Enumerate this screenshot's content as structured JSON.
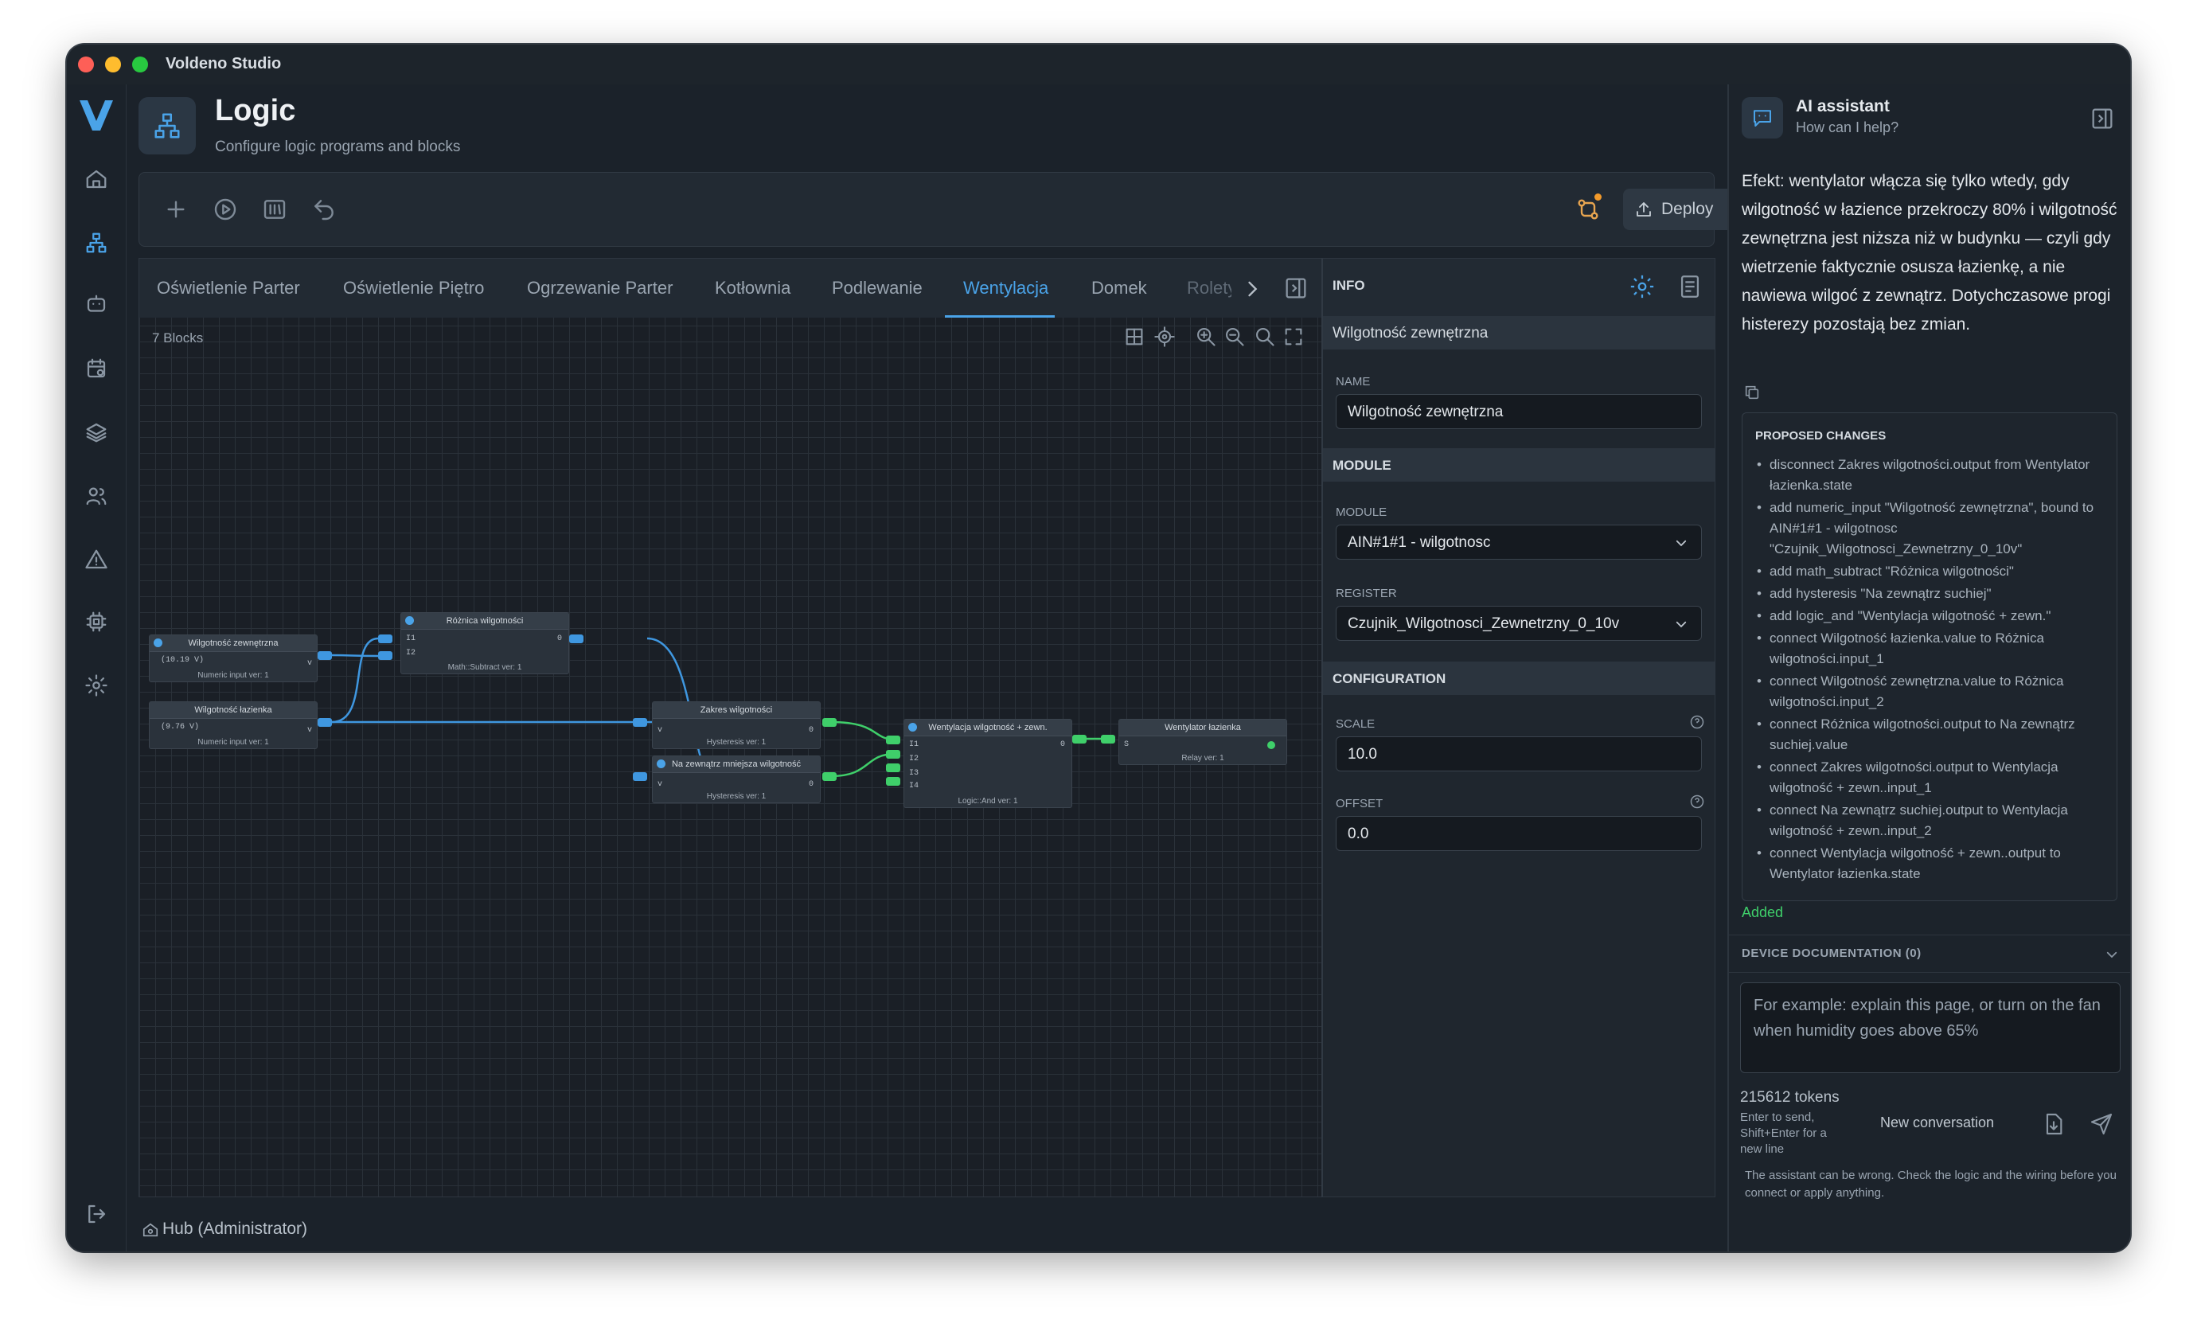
{
  "window": {
    "title": "Voldeno Studio"
  },
  "header": {
    "title": "Logic",
    "subtitle": "Configure logic programs and blocks"
  },
  "toolbar": {
    "deploy_label": "Deploy"
  },
  "tabs": [
    "Oświetlenie Parter",
    "Oświetlenie Piętro",
    "Ogrzewanie Parter",
    "Kotłownia",
    "Podlewanie",
    "Wentylacja",
    "Domek",
    "Rolety"
  ],
  "active_tab": "Wentylacja",
  "canvas": {
    "blocks_count": "7 Blocks",
    "blocks": [
      {
        "title": "Wilgotność zewnętrzna",
        "value": "(10.19 V)",
        "footer": "Numeric input ver: 1",
        "port": "v"
      },
      {
        "title": "Wilgotność łazienka",
        "value": "(9.76 V)",
        "footer": "Numeric input ver: 1",
        "port": "v"
      },
      {
        "title": "Różnica wilgotności",
        "footer": "Math::Subtract ver: 1",
        "in1": "I1",
        "in2": "I2",
        "out": "0"
      },
      {
        "title": "Zakres wilgotności",
        "footer": "Hysteresis ver: 1",
        "in": "v",
        "out": "0"
      },
      {
        "title": "Na zewnątrz mniejsza wilgotność",
        "footer": "Hysteresis ver: 1",
        "in": "v",
        "out": "0"
      },
      {
        "title": "Wentylacja wilgotność + zewn.",
        "footer": "Logic::And ver: 1",
        "in1": "I1",
        "in2": "I2",
        "in3": "I3",
        "in4": "I4",
        "out": "0"
      },
      {
        "title": "Wentylator łazienka",
        "footer": "Relay ver: 1",
        "in": "S"
      }
    ]
  },
  "info_panel": {
    "title": "INFO",
    "selected": "Wilgotność zewnętrzna",
    "name_label": "NAME",
    "name_value": "Wilgotność zewnętrzna",
    "module_section": "MODULE",
    "module_label": "MODULE",
    "module_value": "AIN#1#1 - wilgotnosc",
    "register_label": "REGISTER",
    "register_value": "Czujnik_Wilgotnosci_Zewnetrzny_0_10v",
    "config_section": "CONFIGURATION",
    "scale_label": "SCALE",
    "scale_value": "10.0",
    "offset_label": "OFFSET",
    "offset_value": "0.0"
  },
  "assistant": {
    "title": "AI assistant",
    "subtitle": "How can I help?",
    "message": "Efekt: wentylator włącza się tylko wtedy, gdy wilgotność w łazience przekroczy 80% i wilgotność zewnętrzna jest niższa niż w budynku — czyli gdy wietrzenie faktycznie osusza łazienkę, a nie nawiewa wilgoć z zewnątrz. Dotychczasowe progi histerezy pozostają bez zmian.",
    "proposed_title": "PROPOSED CHANGES",
    "changes": [
      "disconnect Zakres wilgotności.output from Wentylator łazienka.state",
      "add numeric_input \"Wilgotność zewnętrzna\", bound to AIN#1#1 - wilgotnosc \"Czujnik_Wilgotnosci_Zewnetrzny_0_10v\"",
      "add math_subtract \"Różnica wilgotności\"",
      "add hysteresis \"Na zewnątrz suchiej\"",
      "add logic_and \"Wentylacja wilgotność + zewn.\"",
      "connect Wilgotność łazienka.value to Różnica wilgotności.input_1",
      "connect Wilgotność zewnętrzna.value to Różnica wilgotności.input_2",
      "connect Różnica wilgotności.output to Na zewnątrz suchiej.value",
      "connect Zakres wilgotności.output to Wentylacja wilgotność + zewn..input_1",
      "connect Na zewnątrz suchiej.output to Wentylacja wilgotność + zewn..input_2",
      "connect Wentylacja wilgotność + zewn..output to Wentylator łazienka.state"
    ],
    "status": "Added",
    "device_doc": "DEVICE DOCUMENTATION (0)",
    "input_placeholder": "For example: explain this page, or turn on the fan when humidity goes above 65%",
    "tokens": "215612 tokens",
    "send_hint": "Enter to send, Shift+Enter for a new line",
    "new_conversation": "New conversation",
    "disclaimer": "The assistant can be wrong. Check the logic and the wiring before you connect or apply anything."
  },
  "statusbar": {
    "text": "Hub (Administrator)"
  },
  "colors": {
    "accent": "#4aa3e8",
    "wire_blue": "#3f97e0",
    "wire_green": "#3fcf6a",
    "badge_orange": "#f39a2b"
  }
}
